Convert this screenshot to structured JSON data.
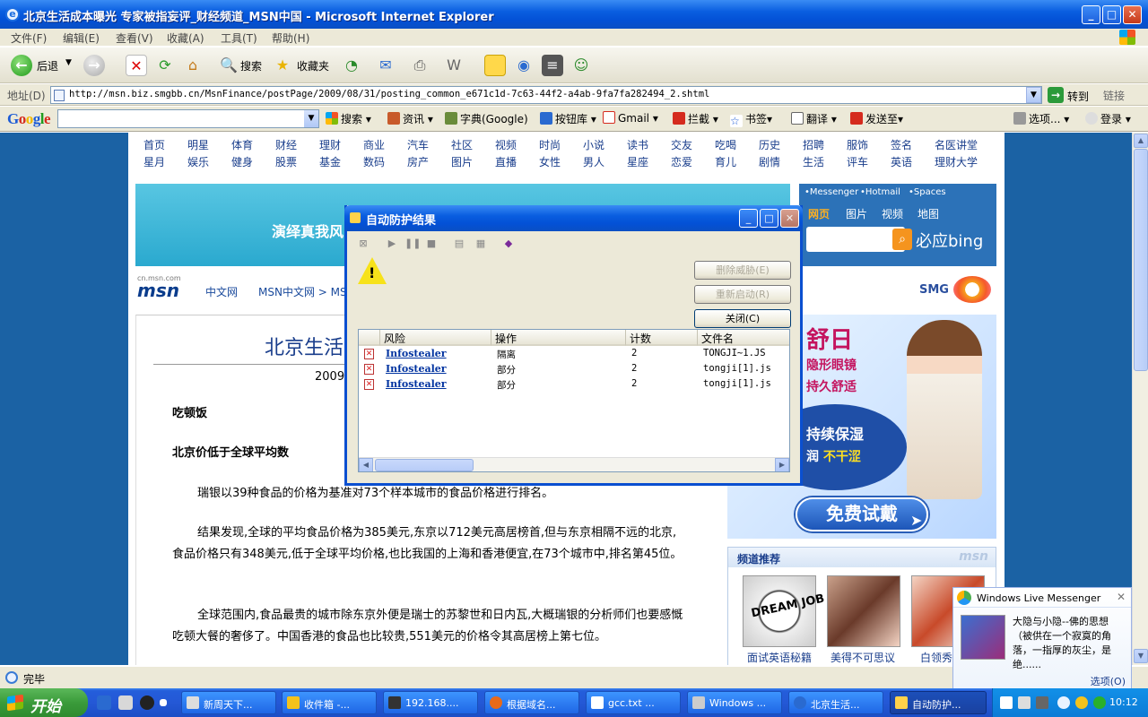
{
  "window": {
    "title": "北京生活成本曝光 专家被指妄评_财经频道_MSN中国 - Microsoft Internet Explorer",
    "min": "_",
    "max": "□",
    "close": "✕"
  },
  "menu": [
    "文件(F)",
    "编辑(E)",
    "查看(V)",
    "收藏(A)",
    "工具(T)",
    "帮助(H)"
  ],
  "toolbar": {
    "back": "后退",
    "search": "搜索",
    "favorites": "收藏夹"
  },
  "address": {
    "label": "地址(D)",
    "url": "http://msn.biz.smgbb.cn/MsnFinance/postPage/2009/08/31/posting_common_e671c1d-7c63-44f2-a4ab-9fa7fa282494_2.shtml",
    "go": "转到",
    "links": "链接"
  },
  "google": {
    "logo": "Google",
    "items": [
      "搜索",
      "资讯",
      "字典(Google)",
      "按钮库",
      "Gmail",
      "拦截",
      "书签",
      "翻译",
      "发送至",
      "选项...",
      "登录"
    ]
  },
  "channels": {
    "row1": [
      "首页",
      "明星",
      "体育",
      "财经",
      "理财",
      "商业",
      "汽车",
      "社区",
      "视频",
      "时尚",
      "小说",
      "读书",
      "交友",
      "吃喝",
      "历史",
      "招聘",
      "服饰",
      "签名",
      "名医讲堂"
    ],
    "row2": [
      "星月",
      "娱乐",
      "健身",
      "股票",
      "基金",
      "数码",
      "房产",
      "图片",
      "直播",
      "女性",
      "男人",
      "星座",
      "恋爱",
      "育儿",
      "剧情",
      "生活",
      "评车",
      "英语",
      "理财大学"
    ]
  },
  "banner": {
    "text": "演绎真我风"
  },
  "msn": {
    "small": "cn.msn.com",
    "logo": "msn",
    "cn": "中文网",
    "breadcrumb": "MSN中文网 > MS"
  },
  "msnsearch": {
    "links": [
      "•Messenger",
      "•Hotmail",
      "•Spaces"
    ],
    "tabs": [
      "网页",
      "图片",
      "视频",
      "地图"
    ],
    "bing": "必应bing"
  },
  "smg": {
    "text": "SMG"
  },
  "article": {
    "title": "北京生活",
    "date": "2009",
    "paragraphs": [
      {
        "text": "吃顿饭",
        "bold": true
      },
      {
        "text": "北京价低于全球平均数",
        "bold": true
      },
      {
        "text": "瑞银以39种食品的价格为基准对73个样本城市的食品价格进行排名。",
        "bold": false
      },
      {
        "text": "结果发现,全球的平均食品价格为385美元,东京以712美元高居榜首,但与东京相隔不远的北京,食品价格只有348美元,低于全球平均价格,也比我国的上海和香港便宜,在73个城市中,排名第45位。",
        "bold": false
      },
      {
        "text": "全球范围内,食品最贵的城市除东京外便是瑞士的苏黎世和日内瓦,大概瑞银的分析师们也要感慨吃顿大餐的奢侈了。中国香港的食品也比较贵,551美元的价格令其高居榜上第七位。",
        "bold": false
      }
    ]
  },
  "ad": {
    "brand": "舒日",
    "line1": "隐形眼镜",
    "line2": "持久舒适",
    "bubble1": "持续保湿",
    "bubble2a": "润",
    "bubble2b": "不干涩",
    "button": "免费试戴"
  },
  "recommend": {
    "title": "频道推荐",
    "watermark": "msn",
    "items": [
      "面试英语秘籍",
      "美得不可思议",
      "白领秀"
    ],
    "thumb1_text": "DREAM JOB"
  },
  "dialog": {
    "title": "自动防护结果",
    "buttons": [
      "删除威胁(E)",
      "重新启动(R)",
      "关闭(C)"
    ],
    "columns": [
      "风险",
      "操作",
      "计数",
      "文件名"
    ],
    "rows": [
      {
        "risk": "Infostealer",
        "action": "隔离",
        "count": "2",
        "file": "TONGJI~1.JS"
      },
      {
        "risk": "Infostealer",
        "action": "部分",
        "count": "2",
        "file": "tongji[1].js"
      },
      {
        "risk": "Infostealer",
        "action": "部分",
        "count": "2",
        "file": "tongji[1].js"
      }
    ]
  },
  "status": {
    "text": "完毕"
  },
  "messenger": {
    "title": "Windows Live Messenger",
    "message": "大隐与小隐--佛的思想（被供在一个寂寞的角落，一指厚的灰尘，是绝......",
    "options": "选项(O)"
  },
  "taskbar": {
    "start": "开始",
    "tasks": [
      "新周天下...",
      "收件箱 -...",
      "192.168....",
      "根据域名...",
      "gcc.txt ...",
      "Windows ...",
      "北京生活...",
      "自动防护..."
    ],
    "clock": "10:12"
  },
  "colors": {
    "accent": "#0a5ee0",
    "link": "#1a3e8c",
    "viewport_bg": "#1b62a4"
  }
}
